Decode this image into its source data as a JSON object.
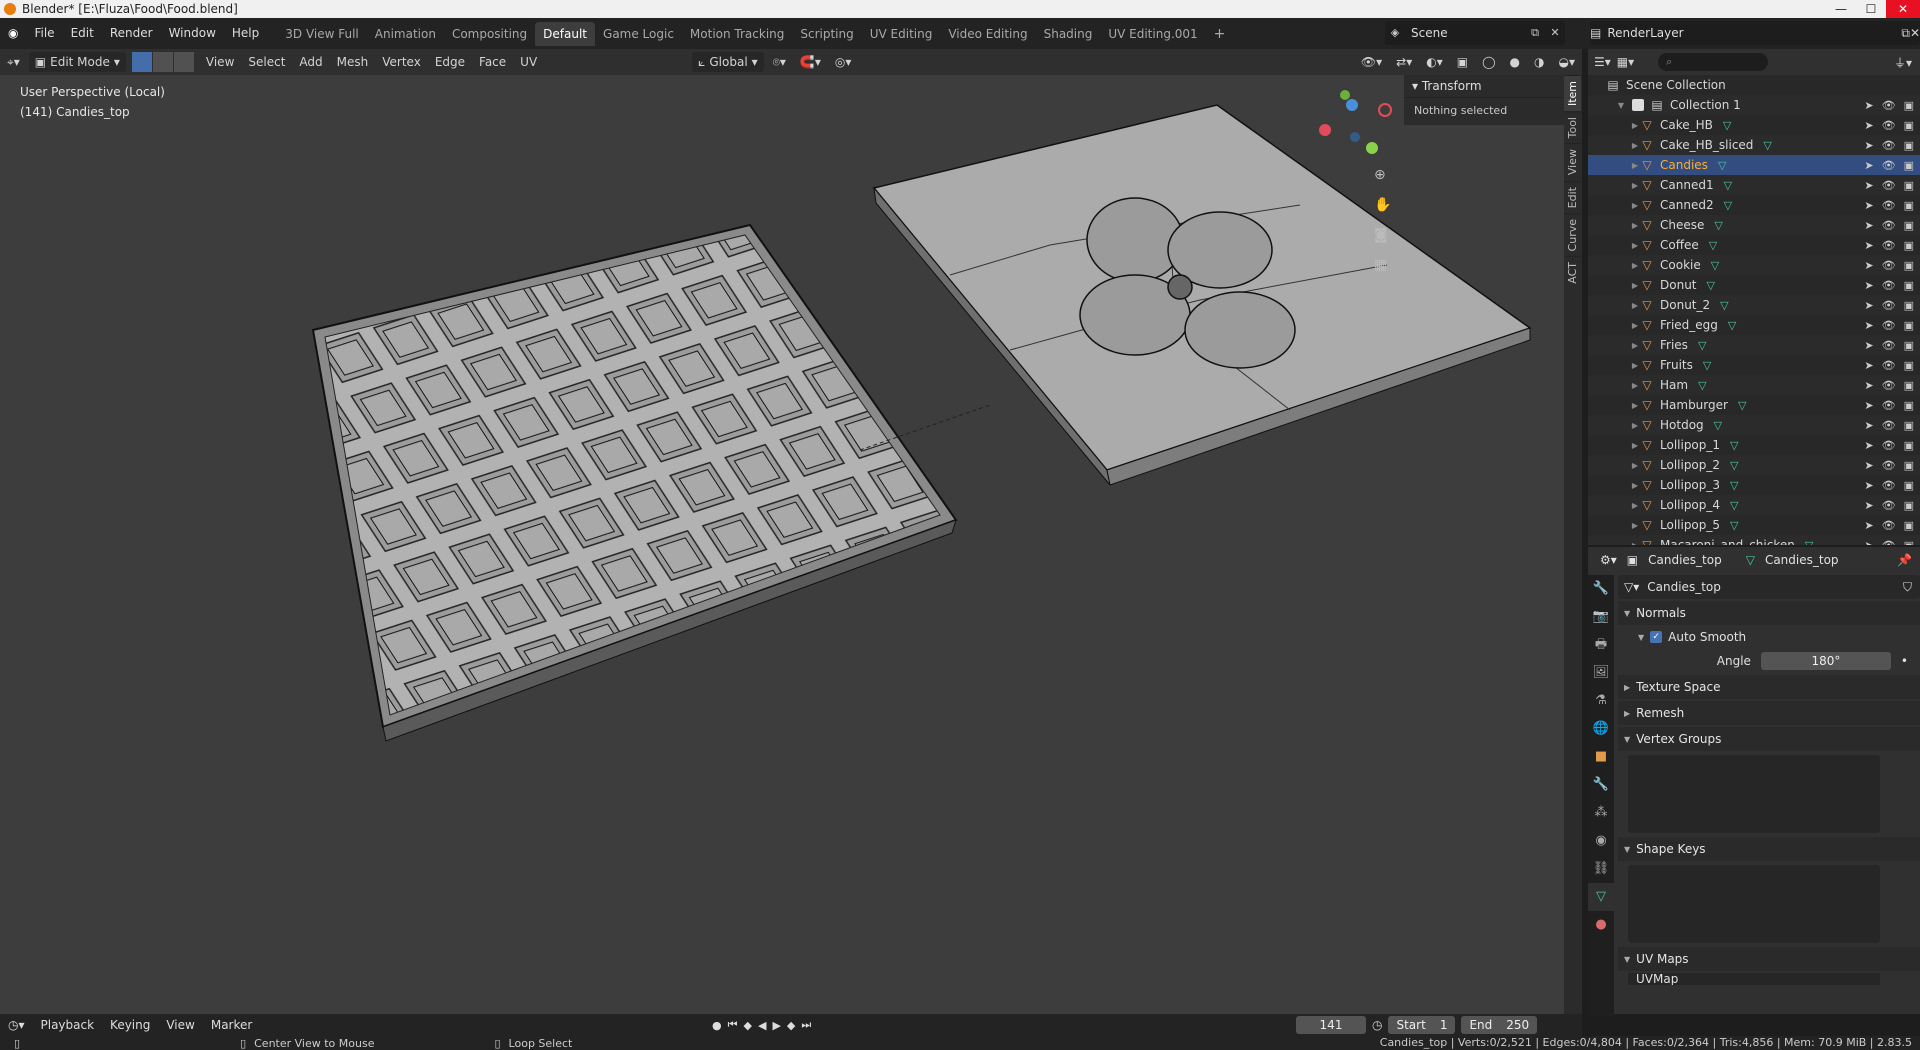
{
  "window": {
    "title": "Blender* [E:\\Fluza\\Food\\Food.blend]"
  },
  "menu": [
    "File",
    "Edit",
    "Render",
    "Window",
    "Help"
  ],
  "workspaces": [
    {
      "label": "3D View Full"
    },
    {
      "label": "Animation"
    },
    {
      "label": "Compositing"
    },
    {
      "label": "Default",
      "active": true
    },
    {
      "label": "Game Logic"
    },
    {
      "label": "Motion Tracking"
    },
    {
      "label": "Scripting"
    },
    {
      "label": "UV Editing"
    },
    {
      "label": "Video Editing"
    },
    {
      "label": "Shading"
    },
    {
      "label": "UV Editing.001"
    }
  ],
  "scene": {
    "name": "Scene",
    "view_layer": "RenderLayer"
  },
  "viewport_header": {
    "mode": "Edit Mode",
    "menus": [
      "View",
      "Select",
      "Add",
      "Mesh",
      "Vertex",
      "Edge",
      "Face",
      "UV"
    ],
    "transform_orientation": "Global"
  },
  "viewport": {
    "perspective": "User Perspective (Local)",
    "object": "(141) Candies_top",
    "sidebar": {
      "panel": "Transform",
      "message": "Nothing selected"
    },
    "tabs": [
      "Item",
      "Tool",
      "View",
      "Edit",
      "Curve",
      "ACT"
    ]
  },
  "outliner": {
    "root": "Scene Collection",
    "collection": "Collection 1",
    "items": [
      {
        "name": "Cake_HB"
      },
      {
        "name": "Cake_HB_sliced"
      },
      {
        "name": "Candies",
        "selected": true
      },
      {
        "name": "Canned1"
      },
      {
        "name": "Canned2"
      },
      {
        "name": "Cheese"
      },
      {
        "name": "Coffee"
      },
      {
        "name": "Cookie"
      },
      {
        "name": "Donut"
      },
      {
        "name": "Donut_2"
      },
      {
        "name": "Fried_egg"
      },
      {
        "name": "Fries"
      },
      {
        "name": "Fruits"
      },
      {
        "name": "Ham"
      },
      {
        "name": "Hamburger"
      },
      {
        "name": "Hotdog"
      },
      {
        "name": "Lollipop_1"
      },
      {
        "name": "Lollipop_2"
      },
      {
        "name": "Lollipop_3"
      },
      {
        "name": "Lollipop_4"
      },
      {
        "name": "Lollipop_5"
      },
      {
        "name": "Macaroni_and_chicken"
      }
    ]
  },
  "properties": {
    "object": "Candies_top",
    "mesh": "Candies_top",
    "datablock": "Candies_top",
    "normals": {
      "label": "Normals",
      "auto_smooth": "Auto Smooth",
      "angle_label": "Angle",
      "angle": "180°"
    },
    "panels": [
      "Texture Space",
      "Remesh",
      "Vertex Groups",
      "Shape Keys",
      "UV Maps"
    ],
    "uvmap": "UVMap"
  },
  "timeline": {
    "menus": [
      "Playback",
      "Keying",
      "View",
      "Marker"
    ],
    "current_frame": "141",
    "start_label": "Start",
    "start": "1",
    "end_label": "End",
    "end": "250"
  },
  "statusbar": {
    "hint1": "Center View to Mouse",
    "hint2": "Loop Select",
    "stats": "Candies_top | Verts:0/2,521 | Edges:0/4,804 | Faces:0/2,364 | Tris:4,856 | Mem: 70.9 MiB | 2.83.5"
  },
  "colors": {
    "accent": "#4772b3",
    "selected_text": "#ffaf29",
    "mesh_data": "#4bc4a0",
    "object": "#e09a4a"
  }
}
